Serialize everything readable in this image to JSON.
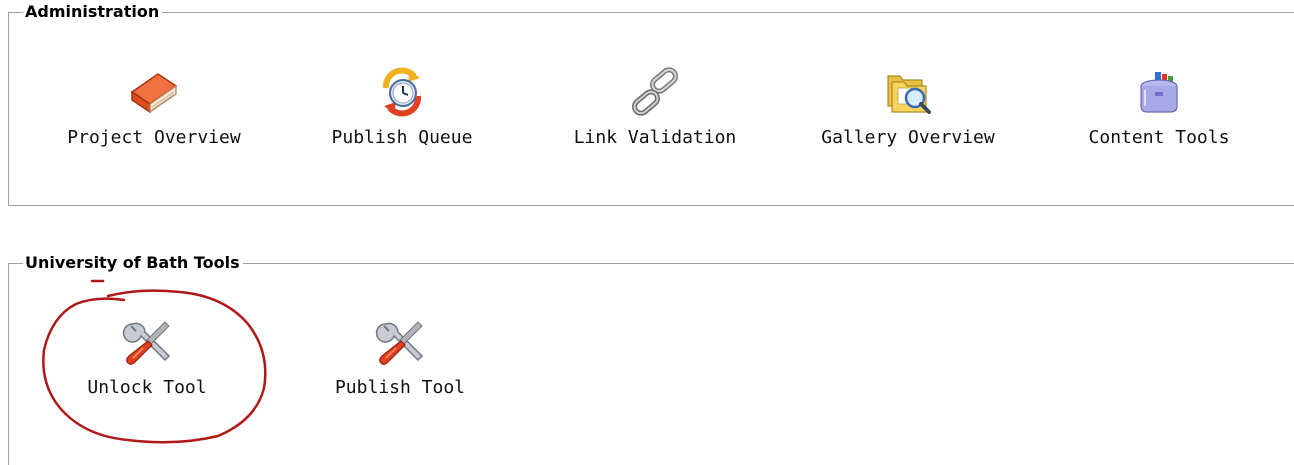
{
  "administration": {
    "legend": "Administration",
    "items": [
      {
        "label": "Project Overview",
        "icon": "book-icon"
      },
      {
        "label": "Publish Queue",
        "icon": "publish-queue-clock-icon"
      },
      {
        "label": "Link Validation",
        "icon": "chain-link-icon"
      },
      {
        "label": "Gallery Overview",
        "icon": "folders-magnifier-icon"
      },
      {
        "label": "Content Tools",
        "icon": "toolbox-icon"
      }
    ]
  },
  "bath_tools": {
    "legend": "University of Bath Tools",
    "items": [
      {
        "label": "Unlock Tool",
        "icon": "wrench-screwdriver-icon"
      },
      {
        "label": "Publish Tool",
        "icon": "wrench-screwdriver-icon"
      }
    ]
  },
  "colors": {
    "panel_border": "#a0a0a0",
    "annotation_circle": "#b01818"
  }
}
